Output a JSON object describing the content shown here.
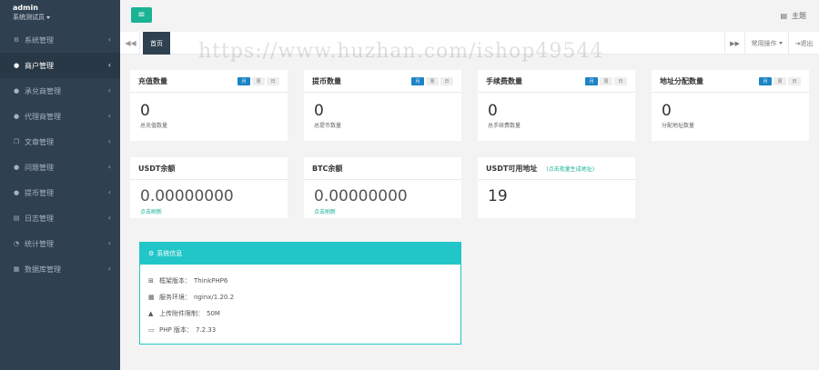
{
  "user": {
    "name": "admin",
    "role": "系统测试员"
  },
  "sidebar": {
    "items": [
      {
        "label": "系统管理",
        "icon": "gear-icon",
        "glyph": "⚙",
        "active": false
      },
      {
        "label": "商户管理",
        "icon": "user-icon",
        "glyph": "●",
        "active": true
      },
      {
        "label": "承兑商管理",
        "icon": "user-icon",
        "glyph": "●",
        "active": false
      },
      {
        "label": "代理商管理",
        "icon": "user-icon",
        "glyph": "●",
        "active": false
      },
      {
        "label": "文章管理",
        "icon": "copy-icon",
        "glyph": "❐",
        "active": false
      },
      {
        "label": "问题管理",
        "icon": "comment-icon",
        "glyph": "●",
        "active": false
      },
      {
        "label": "提币管理",
        "icon": "user-icon",
        "glyph": "●",
        "active": false
      },
      {
        "label": "日志管理",
        "icon": "list-icon",
        "glyph": "▤",
        "active": false
      },
      {
        "label": "统计管理",
        "icon": "chart-icon",
        "glyph": "◔",
        "active": false
      },
      {
        "label": "数据库管理",
        "icon": "database-icon",
        "glyph": "▦",
        "active": false
      }
    ]
  },
  "topbar": {
    "menu_icon": "≡",
    "theme_label": "主题"
  },
  "tabs": {
    "home": "首页",
    "common_ops": "常用操作",
    "logout": "退出"
  },
  "watermark": "https://www.huzhan.com/ishop49544",
  "stats": [
    {
      "title": "充值数量",
      "value": "0",
      "sub": "总充值数量"
    },
    {
      "title": "提币数量",
      "value": "0",
      "sub": "总提币数量"
    },
    {
      "title": "手续费数量",
      "value": "0",
      "sub": "总手续费数量"
    },
    {
      "title": "地址分配数量",
      "value": "0",
      "sub": "分配地址数量"
    }
  ],
  "period_toggles": [
    "月",
    "周",
    "日"
  ],
  "balances": [
    {
      "title": "USDT余额",
      "value": "0.00000000",
      "sub": "点击刷新"
    },
    {
      "title": "BTC余额",
      "value": "0.00000000",
      "sub": "点击刷新"
    }
  ],
  "usdt_address": {
    "title": "USDT可用地址",
    "link": "(点击批量生成地址)",
    "value": "19"
  },
  "system_info": {
    "title": "系统信息",
    "rows": [
      {
        "icon": "sitemap-icon",
        "glyph": "⊞",
        "label": "框架版本：",
        "value": "ThinkPHP6"
      },
      {
        "icon": "windows-icon",
        "glyph": "▦",
        "label": "服务环境：",
        "value": "nginx/1.20.2"
      },
      {
        "icon": "warning-icon",
        "glyph": "▲",
        "label": "上传附件限制：",
        "value": "50M"
      },
      {
        "icon": "card-icon",
        "glyph": "▭",
        "label": "PHP 版本：",
        "value": "7.2.33"
      }
    ]
  },
  "colors": {
    "sidebar": "#2f4050",
    "accent": "#1ab394",
    "info": "#23c6c8",
    "toggle_on": "#1c84c6"
  }
}
